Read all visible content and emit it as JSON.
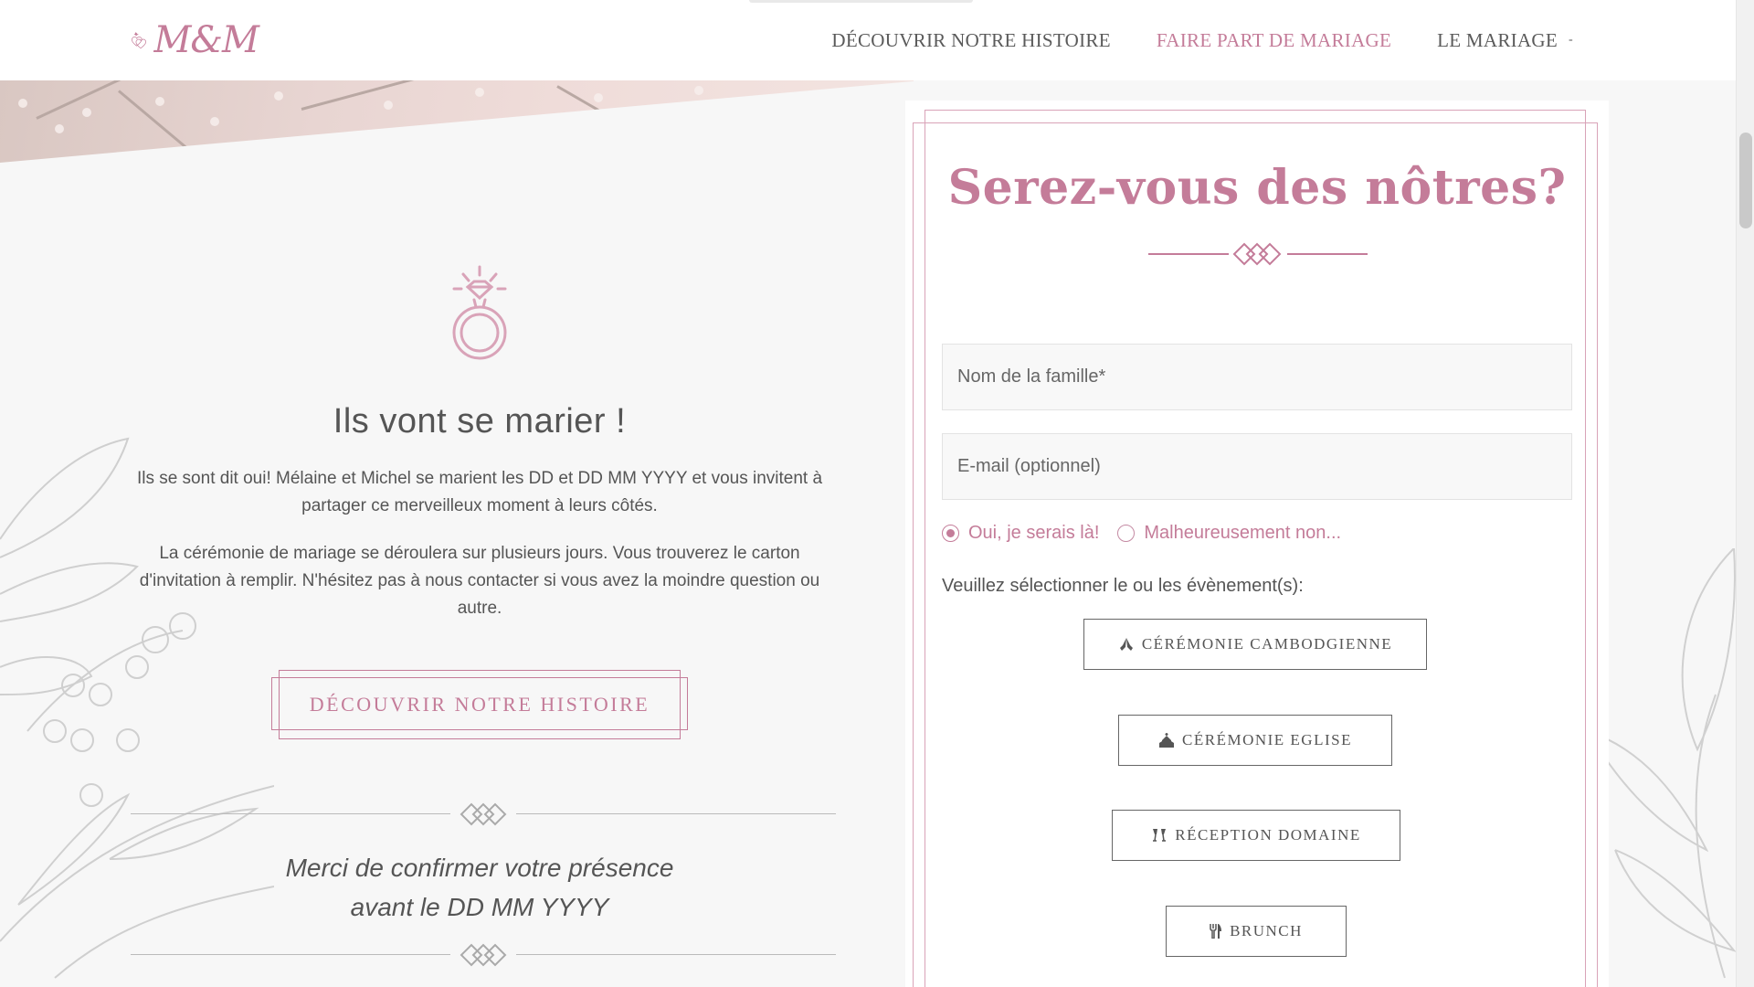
{
  "brand": {
    "logo_text": "M&M"
  },
  "nav": {
    "items": [
      {
        "label": "DÉCOUVRIR NOTRE HISTOIRE"
      },
      {
        "label": "FAIRE PART DE MARIAGE",
        "active": true
      },
      {
        "label": "LE MARIAGE"
      }
    ],
    "dropdown_caret": "-"
  },
  "intro": {
    "title": "Ils vont se marier !",
    "paragraph1": "Ils se sont dit oui! Mélaine et Michel se marient les DD et DD MM YYYY et vous invitent à partager ce merveilleux moment à leurs côtés.",
    "paragraph2": "La cérémonie de mariage se déroulera sur plusieurs jours. Vous trouverez le carton d'invitation à remplir. N'hésitez pas à nous contacter si vous avez la moindre question ou autre.",
    "story_button": "DÉCOUVRIR NOTRE HISTOIRE",
    "confirm_line1": "Merci de confirmer votre présence",
    "confirm_line2": "avant le DD MM YYYY"
  },
  "rsvp": {
    "title": "Serez-vous des nôtres?",
    "family_name_placeholder": "Nom de la famille*",
    "email_placeholder": "E-mail (optionnel)",
    "radio_yes": "Oui, je serais là!",
    "radio_no": "Malheureusement non...",
    "radio_selected": "yes",
    "events_label": "Veuillez sélectionner le ou les évènement(s):",
    "events": [
      {
        "label": "CÉRÉMONIE CAMBODGIENNE",
        "icon": "praying-hands-icon"
      },
      {
        "label": "CÉRÉMONIE EGLISE",
        "icon": "church-icon"
      },
      {
        "label": "RÉCEPTION DOMAINE",
        "icon": "champagne-glasses-icon"
      },
      {
        "label": "BRUNCH",
        "icon": "utensils-icon"
      }
    ]
  },
  "colors": {
    "accent": "#c47c99",
    "text": "#555555",
    "background": "#f7f7f7"
  }
}
